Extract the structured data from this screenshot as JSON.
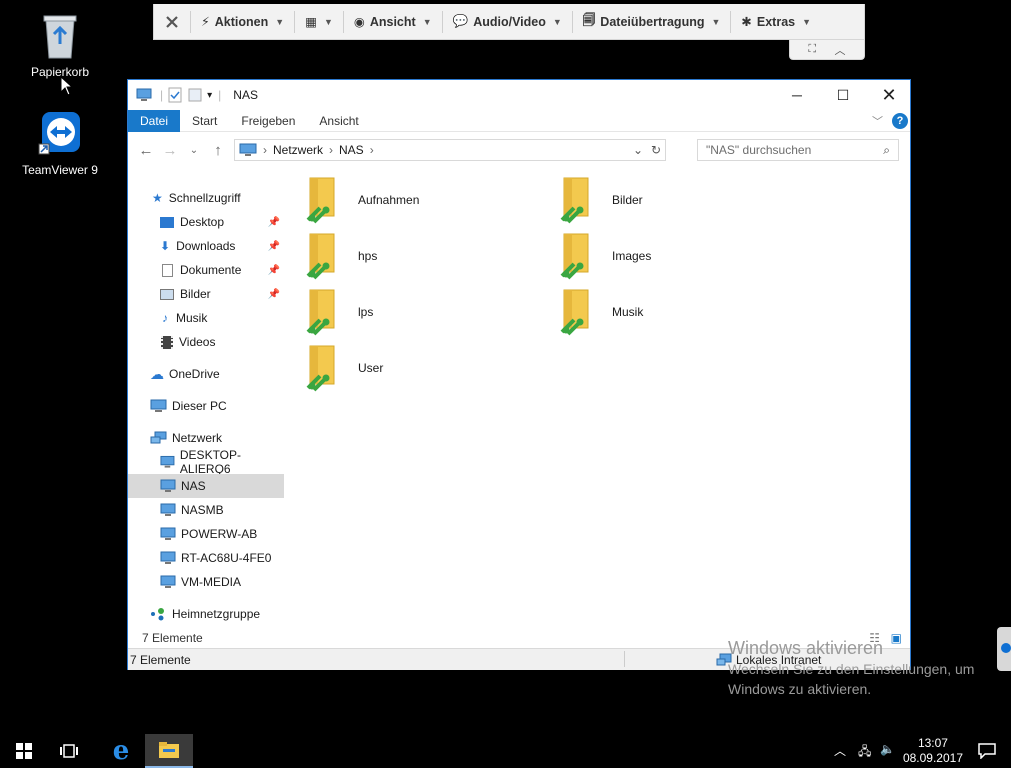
{
  "desktop": {
    "icons": [
      {
        "label": "Papierkorb"
      },
      {
        "label": "TeamViewer 9"
      }
    ]
  },
  "teamviewer_toolbar": {
    "items": [
      {
        "label": "Aktionen"
      },
      {
        "label": "Ansicht"
      },
      {
        "label": "Audio/Video"
      },
      {
        "label": "Dateiübertragung"
      },
      {
        "label": "Extras"
      }
    ]
  },
  "window": {
    "title": "NAS",
    "ribbon_tabs": [
      "Datei",
      "Start",
      "Freigeben",
      "Ansicht"
    ],
    "active_tab": "Datei",
    "address": {
      "segments": [
        "Netzwerk",
        "NAS"
      ]
    },
    "search": {
      "placeholder": "\"NAS\" durchsuchen"
    },
    "sidebar": {
      "items": [
        {
          "label": "Schnellzugriff",
          "icon": "star-icon"
        },
        {
          "label": "Desktop",
          "icon": "desktop-icon",
          "pinned": true
        },
        {
          "label": "Downloads",
          "icon": "download-icon",
          "pinned": true
        },
        {
          "label": "Dokumente",
          "icon": "document-icon",
          "pinned": true
        },
        {
          "label": "Bilder",
          "icon": "pictures-icon",
          "pinned": true
        },
        {
          "label": "Musik",
          "icon": "music-icon"
        },
        {
          "label": "Videos",
          "icon": "video-icon"
        },
        {
          "label": "OneDrive",
          "icon": "cloud-icon"
        },
        {
          "label": "Dieser PC",
          "icon": "pc-icon"
        },
        {
          "label": "Netzwerk",
          "icon": "network-icon"
        },
        {
          "label": "DESKTOP-ALIERQ6",
          "icon": "computer-icon"
        },
        {
          "label": "NAS",
          "icon": "computer-icon",
          "selected": true
        },
        {
          "label": "NASMB",
          "icon": "computer-icon"
        },
        {
          "label": "POWERW-AB",
          "icon": "computer-icon"
        },
        {
          "label": "RT-AC68U-4FE0",
          "icon": "computer-icon"
        },
        {
          "label": "VM-MEDIA",
          "icon": "computer-icon"
        },
        {
          "label": "Heimnetzgruppe",
          "icon": "homegroup-icon"
        }
      ]
    },
    "folders": [
      {
        "name": "Aufnahmen"
      },
      {
        "name": "Bilder"
      },
      {
        "name": "hps"
      },
      {
        "name": "Images"
      },
      {
        "name": "lps"
      },
      {
        "name": "Musik"
      },
      {
        "name": "User"
      }
    ],
    "status_inner": "7 Elemente",
    "status_outer": {
      "count": "7 Elemente",
      "zone": "Lokales Intranet"
    }
  },
  "watermark": {
    "line1": "Windows aktivieren",
    "line2": "Wechseln Sie zu den Einstellungen, um",
    "line3": "Windows zu aktivieren."
  },
  "taskbar": {
    "time": "13:07",
    "date": "08.09.2017"
  },
  "colors": {
    "accent": "#1979ca",
    "folder": "#f3c94e",
    "share": "#3aa641"
  }
}
